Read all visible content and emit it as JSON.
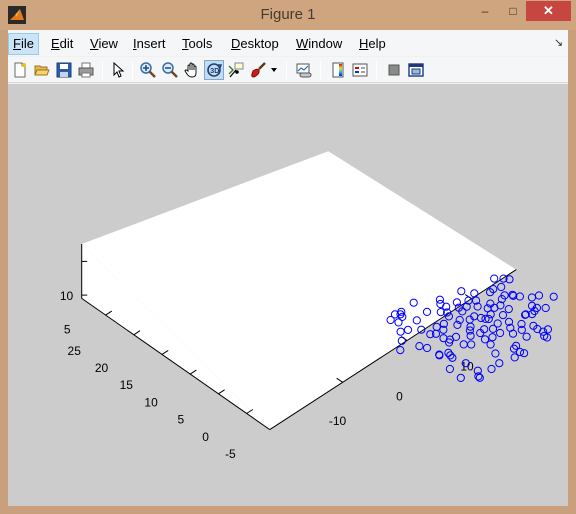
{
  "window": {
    "title": "Figure 1",
    "minimize_glyph": "–",
    "maximize_glyph": "□",
    "close_glyph": "✕"
  },
  "menu": {
    "items": [
      {
        "label_ul": "F",
        "label_rest": "ile"
      },
      {
        "label_ul": "E",
        "label_rest": "dit"
      },
      {
        "label_ul": "V",
        "label_rest": "iew"
      },
      {
        "label_ul": "I",
        "label_rest": "nsert"
      },
      {
        "label_ul": "T",
        "label_rest": "ools"
      },
      {
        "label_ul": "D",
        "label_rest": "esktop"
      },
      {
        "label_ul": "W",
        "label_rest": "indow"
      },
      {
        "label_ul": "H",
        "label_rest": "elp"
      }
    ],
    "dock_glyph": "↘"
  },
  "toolbar": {
    "icons": [
      "new-figure-icon",
      "open-file-icon",
      "save-icon",
      "print-icon",
      "edit-plot-icon",
      "zoom-in-icon",
      "zoom-out-icon",
      "pan-icon",
      "rotate-3d-icon",
      "data-cursor-icon",
      "brush-icon",
      "link-plot-icon",
      "colorbar-icon",
      "legend-icon",
      "hide-plot-tools-icon",
      "show-plot-tools-icon"
    ],
    "active_tool": "rotate-3d-icon"
  },
  "chart_data": {
    "type": "scatter",
    "dimensions": 3,
    "marker": "circle",
    "marker_color": "#0000ff",
    "x_ticks": [
      "-10",
      "0",
      "10"
    ],
    "y_ticks": [
      "-5",
      "0",
      "5",
      "10",
      "15",
      "20",
      "25"
    ],
    "z_ticks": [
      "5",
      "10"
    ],
    "xlim": [
      -18,
      18
    ],
    "ylim": [
      -8,
      28
    ],
    "zlim": [
      5,
      13
    ],
    "grid": false,
    "box": false,
    "projected_points": [
      [
        -10.5,
        26.9
      ],
      [
        -9.8,
        24.9
      ],
      [
        -7.6,
        26.7
      ],
      [
        -6.9,
        27.2
      ],
      [
        -8.5,
        27.6
      ],
      [
        -7.9,
        25.7
      ],
      [
        -10.0,
        21.3
      ],
      [
        -6.4,
        22.3
      ],
      [
        -7.8,
        19.1
      ],
      [
        -7.4,
        16.4
      ],
      [
        -6.4,
        15.5
      ],
      [
        -6.2,
        13.1
      ],
      [
        -6.3,
        11.0
      ],
      [
        -11.6,
        22.1
      ],
      [
        -13.5,
        19.5
      ],
      [
        -15.9,
        17.3
      ],
      [
        -11.9,
        15.1
      ],
      [
        -11.1,
        13.3
      ],
      [
        -10.7,
        9.5
      ],
      [
        -9.1,
        7.4
      ],
      [
        -10.8,
        9.3
      ],
      [
        -9.3,
        6.4
      ],
      [
        -2.8,
        22.8
      ],
      [
        -2.8,
        27.5
      ],
      [
        -4.7,
        17.2
      ],
      [
        -4.3,
        15.3
      ],
      [
        -3.9,
        11.3
      ],
      [
        -5.5,
        11.6
      ],
      [
        -4.4,
        8.0
      ],
      [
        -3.2,
        6.7
      ],
      [
        -0.6,
        20.4
      ],
      [
        0.3,
        19.2
      ],
      [
        1.5,
        20.9
      ],
      [
        1.2,
        22.6
      ],
      [
        4.8,
        17.4
      ],
      [
        6.6,
        15.6
      ],
      [
        7.5,
        22.4
      ],
      [
        3.0,
        16.9
      ],
      [
        2.3,
        13.5
      ],
      [
        0.6,
        15.1
      ],
      [
        -0.9,
        14.2
      ],
      [
        0.8,
        11.5
      ],
      [
        -0.2,
        10.6
      ],
      [
        2.4,
        8.5
      ],
      [
        -1.3,
        9.1
      ],
      [
        0.2,
        5.7
      ],
      [
        3.8,
        13.6
      ],
      [
        4.5,
        12.0
      ],
      [
        5.0,
        11.0
      ],
      [
        5.5,
        10.4
      ],
      [
        8.7,
        9.0
      ],
      [
        11.0,
        9.6
      ],
      [
        12.2,
        13.4
      ],
      [
        13.5,
        13.9
      ],
      [
        14.9,
        12.7
      ],
      [
        15.7,
        11.0
      ],
      [
        14.8,
        12.3
      ],
      [
        17.4,
        8.7
      ],
      [
        19.0,
        8.0
      ],
      [
        21.1,
        5.2
      ],
      [
        -0.3,
        17.9
      ],
      [
        2.1,
        23.8
      ],
      [
        3.3,
        18.5
      ],
      [
        -2.8,
        16.8
      ],
      [
        6.9,
        11.3
      ],
      [
        8.1,
        6.2
      ],
      [
        5.9,
        7.7
      ],
      [
        10.5,
        12.0
      ],
      [
        7.8,
        13.4
      ],
      [
        9.1,
        19.6
      ],
      [
        11.9,
        17.2
      ],
      [
        13.1,
        17.5
      ],
      [
        14.9,
        16.7
      ],
      [
        18.0,
        17.3
      ],
      [
        17.2,
        18.5
      ],
      [
        15.7,
        20.1
      ],
      [
        9.3,
        14.2
      ],
      [
        9.0,
        12.4
      ],
      [
        7.7,
        17.4
      ],
      [
        6.5,
        18.7
      ],
      [
        4.2,
        20.2
      ],
      [
        -8.8,
        8.4
      ],
      [
        -8.4,
        2.7
      ],
      [
        -12.3,
        3.9
      ],
      [
        -12.6,
        -0.3
      ],
      [
        -8.2,
        -1.3
      ],
      [
        -9.4,
        -2.9
      ],
      [
        -9.5,
        -3.5
      ],
      [
        -5.6,
        -3.2
      ],
      [
        -1.4,
        0.2
      ],
      [
        -3.0,
        -3.0
      ],
      [
        0.8,
        -4.1
      ],
      [
        3.3,
        -4.6
      ],
      [
        2.9,
        -3.6
      ],
      [
        2.7,
        -1.7
      ],
      [
        3.7,
        -1.3
      ],
      [
        6.0,
        2.4
      ],
      [
        7.5,
        -0.7
      ],
      [
        11.1,
        1.0
      ],
      [
        11.0,
        -0.5
      ],
      [
        12.6,
        -2.4
      ],
      [
        10.5,
        -3.5
      ],
      [
        10.6,
        -4.4
      ],
      [
        11.3,
        -2.2
      ],
      [
        9.6,
        3.5
      ],
      [
        12.3,
        5.3
      ],
      [
        13.6,
        4.3
      ],
      [
        15.8,
        5.1
      ],
      [
        17.2,
        3.6
      ],
      [
        15.5,
        6.5
      ],
      [
        14.7,
        4.7
      ],
      [
        12.5,
        5.3
      ],
      [
        3.9,
        7.1
      ],
      [
        1.9,
        5.0
      ],
      [
        -0.1,
        3.4
      ],
      [
        0.9,
        8.2
      ],
      [
        4.1,
        4.8
      ],
      [
        6.9,
        4.4
      ],
      [
        8.3,
        1.9
      ]
    ]
  }
}
